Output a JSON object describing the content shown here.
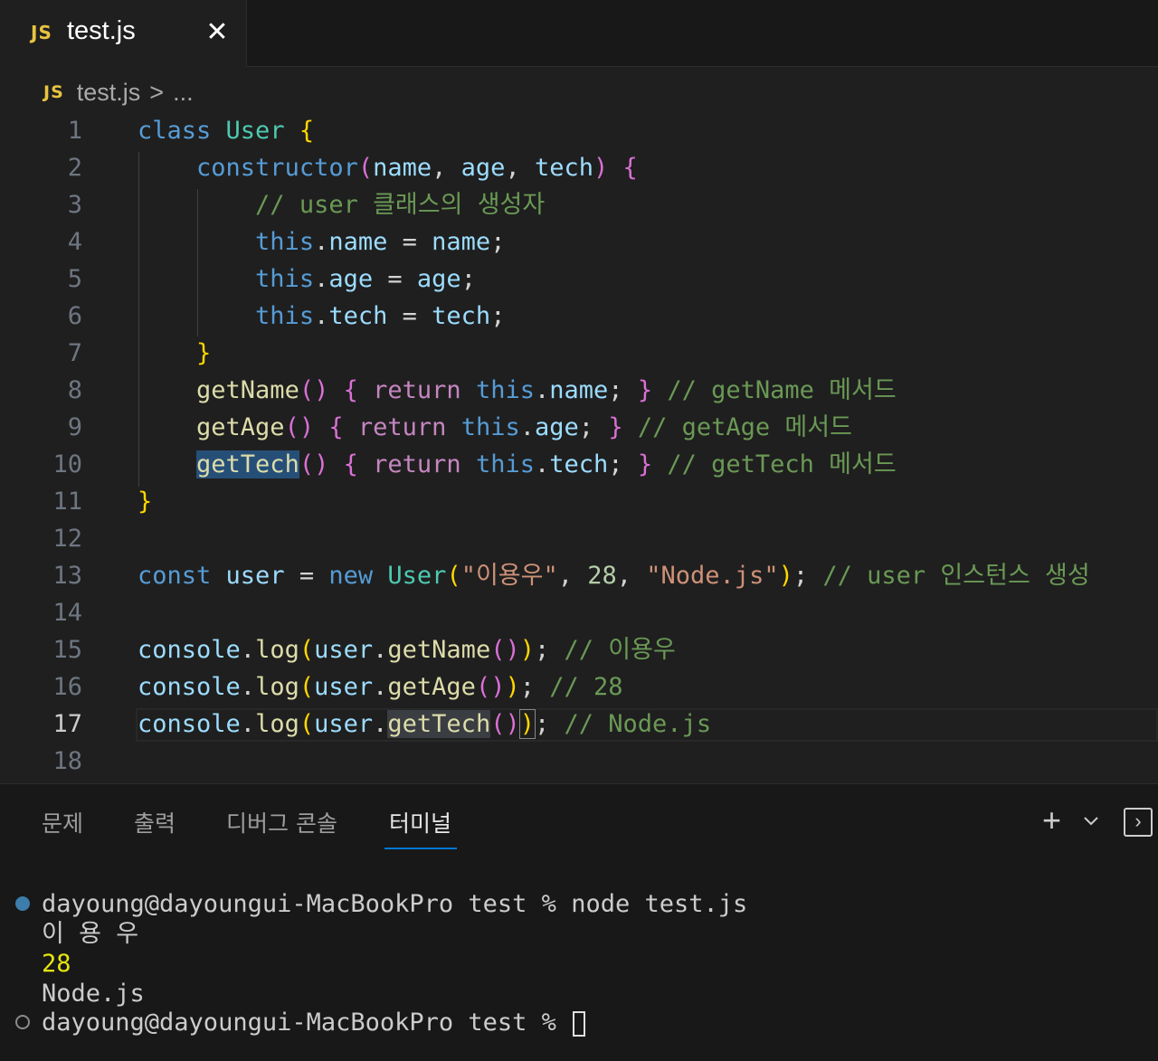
{
  "tab": {
    "icon": "JS",
    "label": "test.js",
    "close_icon": "close-icon"
  },
  "breadcrumb": {
    "icon": "JS",
    "file": "test.js",
    "separator": ">",
    "more": "..."
  },
  "editor": {
    "line_numbers": [
      "1",
      "2",
      "3",
      "4",
      "5",
      "6",
      "7",
      "8",
      "9",
      "10",
      "11",
      "12",
      "13",
      "14",
      "15",
      "16",
      "17",
      "18"
    ],
    "active_line": "17",
    "lines": [
      "class User {",
      "    constructor(name, age, tech) {",
      "        // user 클래스의 생성자",
      "        this.name = name;",
      "        this.age = age;",
      "        this.tech = tech;",
      "    }",
      "    getName() { return this.name; } // getName 메서드",
      "    getAge() { return this.age; } // getAge 메서드",
      "    getTech() { return this.tech; } // getTech 메서드",
      "}",
      "",
      "const user = new User(\"이용우\", 28, \"Node.js\"); // user 인스턴스 생성",
      "",
      "console.log(user.getName()); // 이용우",
      "console.log(user.getAge()); // 28",
      "console.log(user.getTech()); // Node.js",
      ""
    ]
  },
  "panel": {
    "tabs": [
      "문제",
      "출력",
      "디버그 콘솔",
      "터미널"
    ],
    "active_tab": "터미널",
    "actions": {
      "add": "+",
      "dropdown_icon": "chevron-down-icon",
      "maximize_icon": "panel-maximize-icon"
    }
  },
  "terminal": {
    "lines": [
      "dayoung@dayoungui-MacBookPro test % node test.js",
      "이 용 우",
      "28",
      "Node.js",
      "dayoung@dayoungui-MacBookPro test % "
    ]
  }
}
